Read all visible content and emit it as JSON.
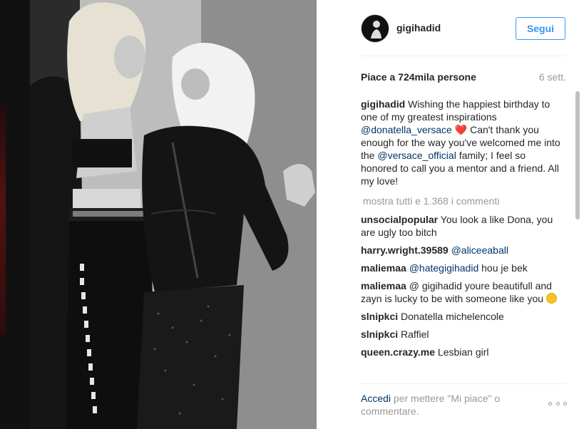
{
  "post": {
    "username": "gigihadid",
    "follow_label": "Segui",
    "likes": "Piace a 724mila persone",
    "time_ago": "6 sett.",
    "caption": {
      "username": "gigihadid",
      "text_1": "Wishing the happiest birthday to one of my greatest inspirations",
      "mention_1": "@donatella_versace",
      "heart": "❤️",
      "text_2": "Can't thank you enough for the way you've welcomed me into the",
      "mention_2": "@versace_official",
      "text_3": "family; I feel so honored to call you a mentor and a friend. All my love!"
    },
    "view_all": "mostra tutti e 1.368 i commenti",
    "comments": [
      {
        "username": "unsocialpopular",
        "text": "You look a like Dona, you are ugly too bitch"
      },
      {
        "username": "harry.wright.39589",
        "mention": "@aliceeaball",
        "text": ""
      },
      {
        "username": "maliemaa",
        "mention": "@hategigihadid",
        "text": "hou je bek"
      },
      {
        "username": "maliemaa",
        "text": "@ gigihadid youre beautifull and zayn is lucky to be with someone like you"
      },
      {
        "username": "slnipkci",
        "text": "Donatella michelencole"
      },
      {
        "username": "slnipkci",
        "text": "Raffiel"
      },
      {
        "username": "queen.crazy.me",
        "text": "Lesbian girl"
      }
    ],
    "footer": {
      "login": "Accedi",
      "rest": "per mettere \"Mi piace\" o commentare."
    }
  }
}
